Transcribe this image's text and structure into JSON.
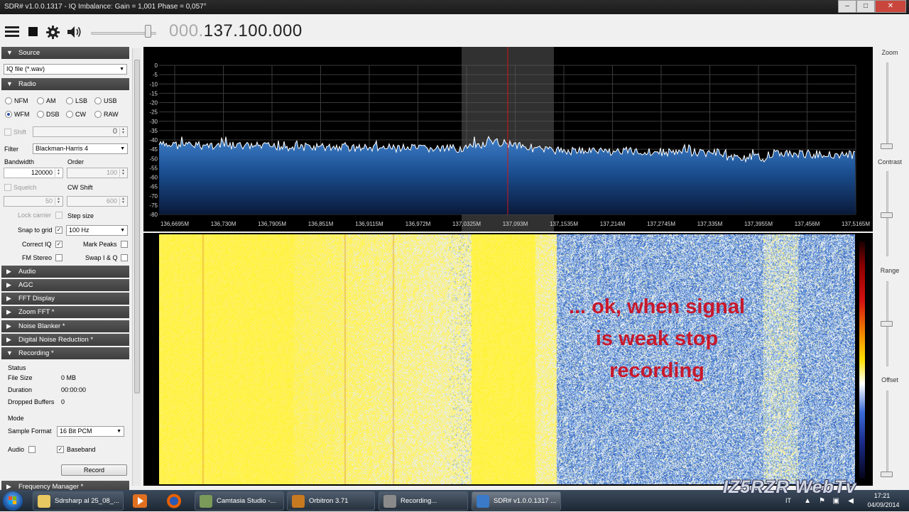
{
  "window": {
    "title": "SDR# v1.0.0.1317 - IQ Imbalance: Gain = 1,001 Phase = 0,057°",
    "minimize_glyph": "–",
    "maximize_glyph": "□",
    "close_glyph": "✕"
  },
  "toolbar": {
    "menu_icon": "hamburger-menu-icon",
    "stop_icon": "stop-icon",
    "settings_icon": "gear-icon",
    "audio_icon": "speaker-icon",
    "frequency_dim": "000.",
    "frequency_main": "137.100.000"
  },
  "left_panel": {
    "source": {
      "header": "Source",
      "device": "IQ file (*.wav)"
    },
    "radio": {
      "header": "Radio",
      "modes": [
        "NFM",
        "AM",
        "LSB",
        "USB",
        "WFM",
        "DSB",
        "CW",
        "RAW"
      ],
      "selected_mode": "WFM",
      "shift_label": "Shift",
      "shift_value": "0",
      "filter_label": "Filter",
      "filter_value": "Blackman-Harris 4",
      "bandwidth_label": "Bandwidth",
      "bandwidth_value": "120000",
      "order_label": "Order",
      "order_value": "100",
      "squelch_label": "Squelch",
      "squelch_value": "50",
      "cw_shift_label": "CW Shift",
      "cw_shift_value": "600",
      "lock_carrier_label": "Lock carrier",
      "step_size_label": "Step size",
      "snap_label": "Snap to grid",
      "snap_value": "100 Hz",
      "correct_iq_label": "Correct IQ",
      "mark_peaks_label": "Mark Peaks",
      "fm_stereo_label": "FM Stereo",
      "swap_iq_label": "Swap I & Q"
    },
    "sections": [
      "Audio",
      "AGC",
      "FFT Display",
      "Zoom FFT *",
      "Noise Blanker *",
      "Digital Noise Reduction *",
      "Recording *"
    ],
    "recording": {
      "status_label": "Status",
      "file_size_label": "File Size",
      "file_size_value": "0 MB",
      "duration_label": "Duration",
      "duration_value": "00:00:00",
      "dropped_label": "Dropped Buffers",
      "dropped_value": "0",
      "mode_label": "Mode",
      "sample_format_label": "Sample Format",
      "sample_format_value": "16 Bit PCM",
      "audio_label": "Audio",
      "baseband_label": "Baseband",
      "record_button": "Record"
    },
    "next_section": "Frequency Manager *"
  },
  "spectrum": {
    "db_labels": [
      "0",
      "-5",
      "-10",
      "-15",
      "-20",
      "-25",
      "-30",
      "-35",
      "-40",
      "-45",
      "-50",
      "-55",
      "-60",
      "-65",
      "-70",
      "-75",
      "-80"
    ],
    "freq_labels": [
      "136,6695M",
      "136,730M",
      "136,7905M",
      "136,851M",
      "136,9115M",
      "136,972M",
      "137,0325M",
      "137,093M",
      "137,1535M",
      "137,214M",
      "137,2745M",
      "137,335M",
      "137,3955M",
      "137,456M",
      "137,5165M"
    ]
  },
  "overlay": {
    "lines": [
      "... ok, when signal",
      "is weak stop",
      "recording"
    ]
  },
  "right_panel": {
    "zoom_label": "Zoom",
    "contrast_label": "Contrast",
    "range_label": "Range",
    "offset_label": "Offset"
  },
  "taskbar": {
    "items": [
      "Sdrsharp al 25_08_...",
      "Camtasia Studio -...",
      "Orbitron 3.71",
      "Recording...",
      "SDR# v1.0.0.1317 ..."
    ],
    "lang": "IT",
    "time": "17:21",
    "date": "04/09/2014"
  },
  "watermark": "IZ5RZR WebTv",
  "colors": {
    "accent_header": "#4a4a4a",
    "spectrum_fill": "#1e5aa0",
    "overlay_text": "#c8192c",
    "cursor_line": "#d01818"
  }
}
